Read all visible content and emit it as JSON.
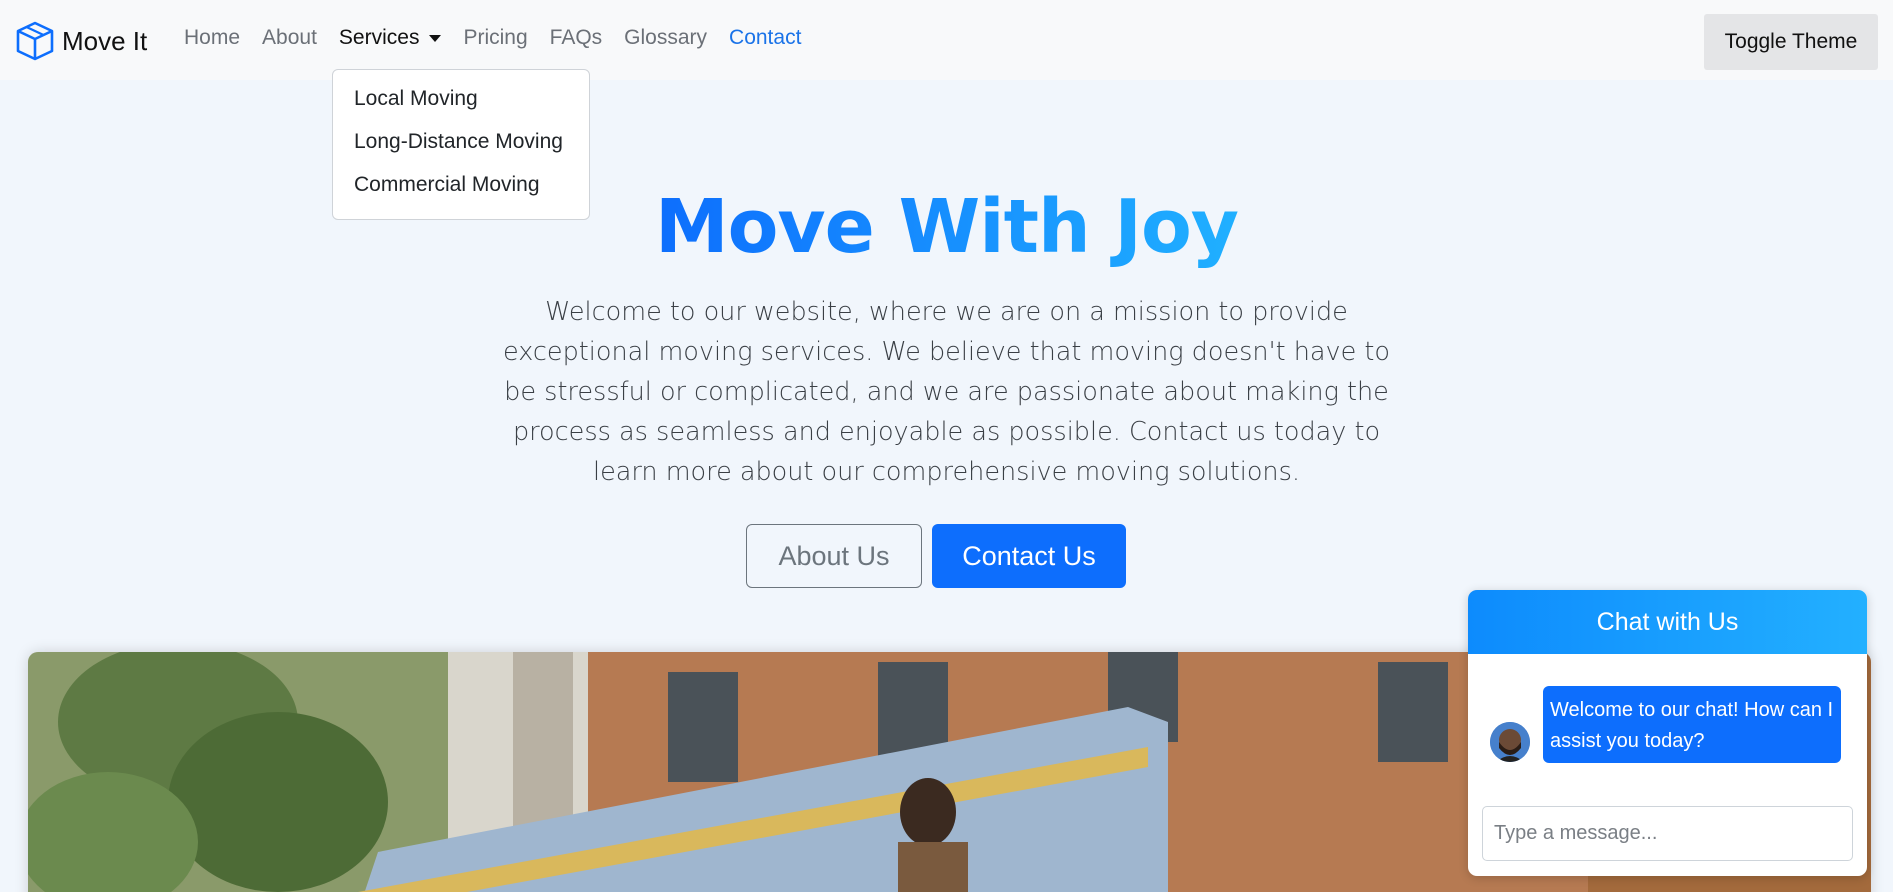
{
  "brand": {
    "name": "Move It",
    "icon": "box-icon"
  },
  "nav": {
    "links": [
      "Home",
      "About",
      "Services",
      "Pricing",
      "FAQs",
      "Glossary",
      "Contact"
    ],
    "toggle_label": "Toggle Theme"
  },
  "dropdown": {
    "items": [
      "Local Moving",
      "Long-Distance Moving",
      "Commercial Moving"
    ]
  },
  "hero": {
    "title": "Move With Joy",
    "text": "Welcome to our website, where we are on a mission to provide exceptional moving services. We believe that moving doesn't have to be stressful or complicated, and we are passionate about making the process as seamless and enjoyable as possible. Contact us today to learn more about our comprehensive moving solutions.",
    "about_label": "About Us",
    "contact_label": "Contact Us"
  },
  "chat": {
    "header": "Chat with Us",
    "message": "Welcome to our chat! How can I assist you today?",
    "placeholder": "Type a message..."
  },
  "colors": {
    "accent": "#0d6efd",
    "chat_header": "#1a9dfd",
    "page_bg": "#f1f6fc"
  }
}
